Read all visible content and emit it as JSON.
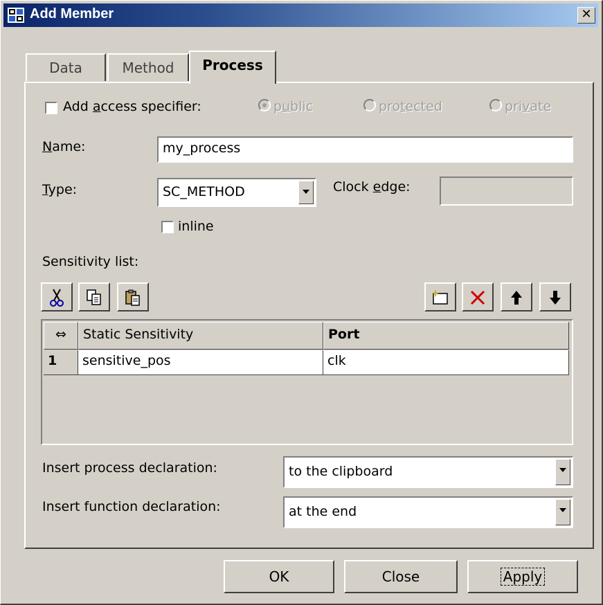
{
  "window": {
    "title": "Add Member",
    "icon": "app-grid-icon",
    "close_symbol": "✕"
  },
  "tabs": [
    {
      "label": "Data",
      "active": false
    },
    {
      "label": "Method",
      "active": false
    },
    {
      "label": "Process",
      "active": true
    }
  ],
  "access": {
    "checkbox_label_pre": "Add ",
    "checkbox_label_u": "a",
    "checkbox_label_post": "ccess specifier:",
    "checked": false,
    "radios": [
      {
        "pre": "p",
        "u": "u",
        "post": "blic",
        "selected": true
      },
      {
        "pre": "pro",
        "u": "t",
        "post": "ected",
        "selected": false
      },
      {
        "pre": "pri",
        "u": "v",
        "post": "ate",
        "selected": false
      }
    ]
  },
  "name": {
    "label_u": "N",
    "label_post": "ame:",
    "value": "my_process"
  },
  "type": {
    "label_u": "T",
    "label_post": "ype:",
    "value": "SC_METHOD"
  },
  "clock_edge": {
    "label_pre": "Clock ",
    "label_u": "e",
    "label_post": "dge:",
    "value": ""
  },
  "inline": {
    "label": "inline",
    "checked": false
  },
  "sensitivity": {
    "label": "Sensitivity list:",
    "toolbar_left": [
      "cut-icon",
      "copy-icon",
      "paste-icon"
    ],
    "toolbar_right": [
      "new-item-icon",
      "delete-icon",
      "move-up-icon",
      "move-down-icon"
    ],
    "columns": [
      "⇔",
      "Static Sensitivity",
      "Port"
    ],
    "rows": [
      {
        "num": "1",
        "sensitivity": "sensitive_pos",
        "port": "clk"
      }
    ]
  },
  "process_decl": {
    "label": "Insert process declaration:",
    "value": "to the clipboard"
  },
  "function_decl": {
    "label": "Insert function declaration:",
    "value": "at the end"
  },
  "buttons": {
    "ok": "OK",
    "close": "Close",
    "apply": "Apply"
  },
  "colors": {
    "face": "#d4d0c8",
    "title_start": "#0a246a",
    "title_end": "#a6caf0",
    "delete_red": "#cc0000"
  }
}
